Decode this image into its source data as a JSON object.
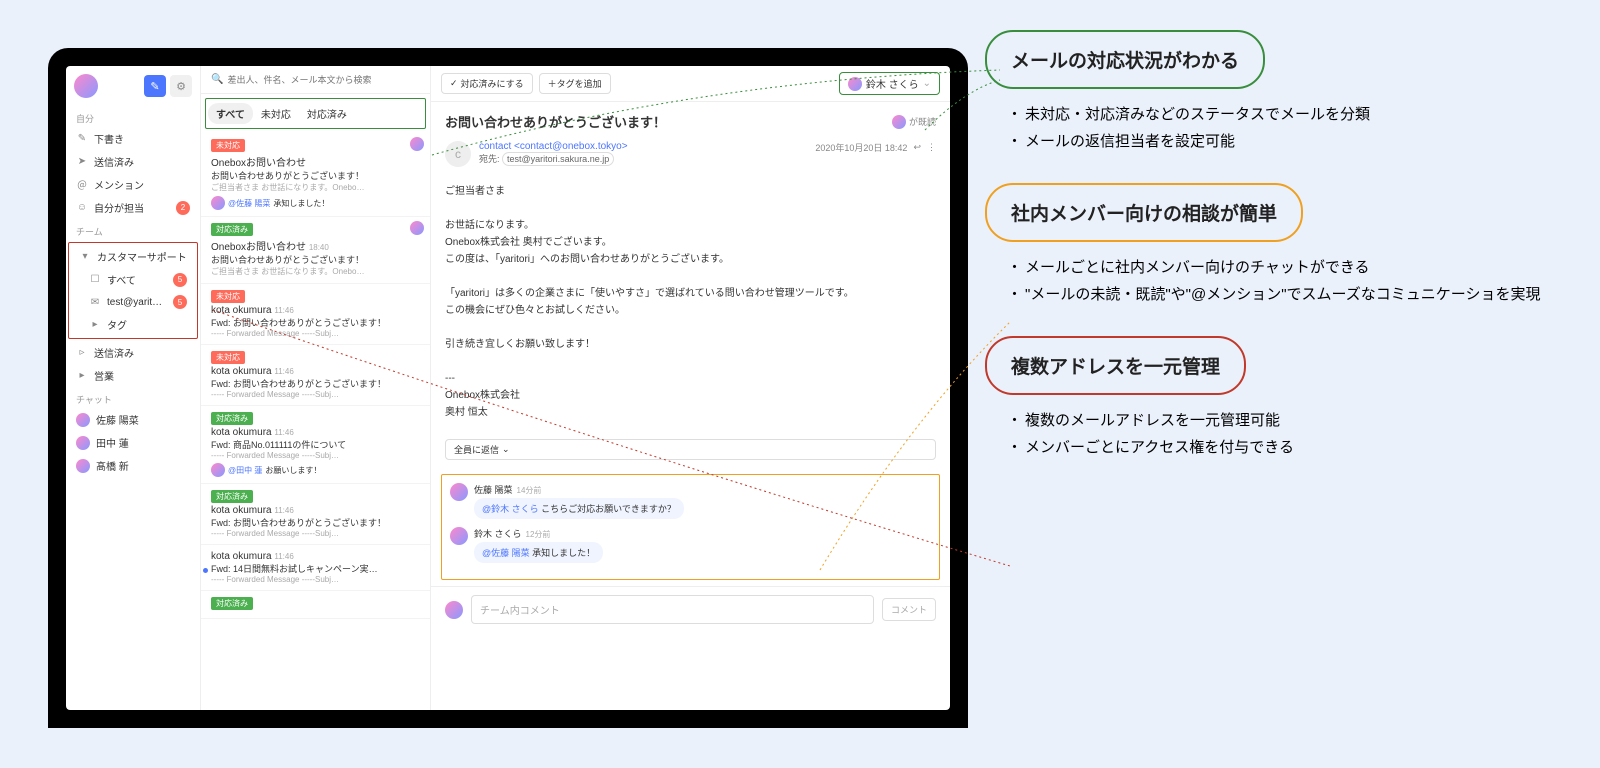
{
  "sidebar": {
    "section_me": "自分",
    "items_me": [
      {
        "icon": "✎",
        "label": "下書き"
      },
      {
        "icon": "➤",
        "label": "送信済み"
      },
      {
        "icon": "＠",
        "label": "メンション"
      },
      {
        "icon": "☺",
        "label": "自分が担当",
        "badge": "2"
      }
    ],
    "section_team": "チーム",
    "team_name": "カスタマーサポート",
    "team_items": [
      {
        "icon": "☐",
        "label": "すべて",
        "badge": "5"
      },
      {
        "icon": "✉",
        "label": "test@yaritori.sak…",
        "badge": "5"
      },
      {
        "icon": "▸",
        "label": "タグ"
      }
    ],
    "sent_team": "送信済み",
    "sales": "営業",
    "section_chat": "チャット",
    "chat_users": [
      {
        "label": "佐藤 陽菜"
      },
      {
        "label": "田中 蓮"
      },
      {
        "label": "髙橋 新"
      }
    ]
  },
  "search": {
    "placeholder": "差出人、件名、メール本文から検索"
  },
  "tabs": {
    "all": "すべて",
    "unhandled": "未対応",
    "handled": "対応済み"
  },
  "status_tags": {
    "unhandled": "未対応",
    "handled": "対応済み"
  },
  "threads": [
    {
      "tag": "red",
      "from": "Oneboxお問い合わせ <contact@…",
      "time": "",
      "sub": "お問い合わせありがとうございます！",
      "pre": "ご担当者さま お世話になります。Onebo…",
      "ann_m": "@佐藤 陽菜",
      "ann_t": "承知しました！",
      "av": true
    },
    {
      "tag": "green",
      "from": "Oneboxお問い合わせ <contact@…",
      "time": "18:40",
      "sub": "お問い合わせありがとうございます！",
      "pre": "ご担当者さま お世話になります。Onebo…",
      "av": true
    },
    {
      "tag": "red",
      "from": "kota okumura <test@yaritori…",
      "time": "11:46",
      "sub": "Fwd: お問い合わせありがとうございます！",
      "pre": "----- Forwarded Message -----Subj…"
    },
    {
      "tag": "red",
      "from": "kota okumura <test@yaritori.sa…",
      "time": "11:46",
      "sub": "Fwd: お問い合わせありがとうございます！",
      "pre": "----- Forwarded Message -----Subj…"
    },
    {
      "tag": "green",
      "from": "kota okumura <test@yaritori.sa…",
      "time": "11:46",
      "sub": "Fwd: 商品No.011111の件について",
      "pre": "----- Forwarded Message -----Subj…",
      "ann_m": "@田中 蓮",
      "ann_t": "お願いします！",
      "av2": true
    },
    {
      "tag": "green",
      "from": "kota okumura <test@yaritori.sa…",
      "time": "11:46",
      "sub": "Fwd: お問い合わせありがとうございます！",
      "pre": "----- Forwarded Message -----Subj…"
    },
    {
      "tag": "",
      "from": "kota okumura <test@yaritori.sa…",
      "time": "11:46",
      "sub": "Fwd: 14日間無料お試しキャンペーン実…",
      "pre": "----- Forwarded Message -----Subj…",
      "dot": true
    },
    {
      "tag": "green",
      "from": "",
      "time": "",
      "sub": "",
      "pre": ""
    }
  ],
  "toolbar": {
    "mark_done": "対応済みにする",
    "add_tag": "＋タグを追加"
  },
  "assignee": {
    "name": "鈴木 さくら"
  },
  "mail": {
    "subject": "お問い合わせありがとうございます！",
    "read": "が既読",
    "from": "contact <contact@onebox.tokyo>",
    "to_label": "宛先:",
    "to": "test@yaritori.sakura.ne.jp",
    "date": "2020年10月20日 18:42",
    "body": "ご担当者さま\n\nお世話になります。\nOnebox株式会社 奥村でございます。\nこの度は、「yaritori」へのお問い合わせありがとうございます。\n\n「yaritori」は多くの企業さまに「使いやすさ」で選ばれている問い合わせ管理ツールです。\nこの機会にぜひ色々とお試しください。\n\n引き続き宜しくお願い致します！\n\n---\nOnebox株式会社\n奥村 恒太",
    "reply_all": "全員に返信"
  },
  "chat": {
    "items": [
      {
        "name": "佐藤 陽菜",
        "time": "14分前",
        "mention": "@鈴木 さくら",
        "text": "こちらご対応お願いできますか？"
      },
      {
        "name": "鈴木 さくら",
        "time": "12分前",
        "mention": "@佐藤 陽菜",
        "text": "承知しました！"
      }
    ],
    "placeholder": "チーム内コメント",
    "send": "コメント"
  },
  "annotations": {
    "a1_title": "メールの対応状況がわかる",
    "a1_items": [
      "未対応・対応済みなどのステータスでメールを分類",
      "メールの返信担当者を設定可能"
    ],
    "a2_title": "社内メンバー向けの相談が簡単",
    "a2_items": [
      "メールごとに社内メンバー向けのチャットができる",
      "\"メールの未読・既読\"や\"@メンション\"でスムーズなコミュニケーショを実現"
    ],
    "a3_title": "複数アドレスを一元管理",
    "a3_items": [
      "複数のメールアドレスを一元管理可能",
      "メンバーごとにアクセス権を付与できる"
    ]
  }
}
